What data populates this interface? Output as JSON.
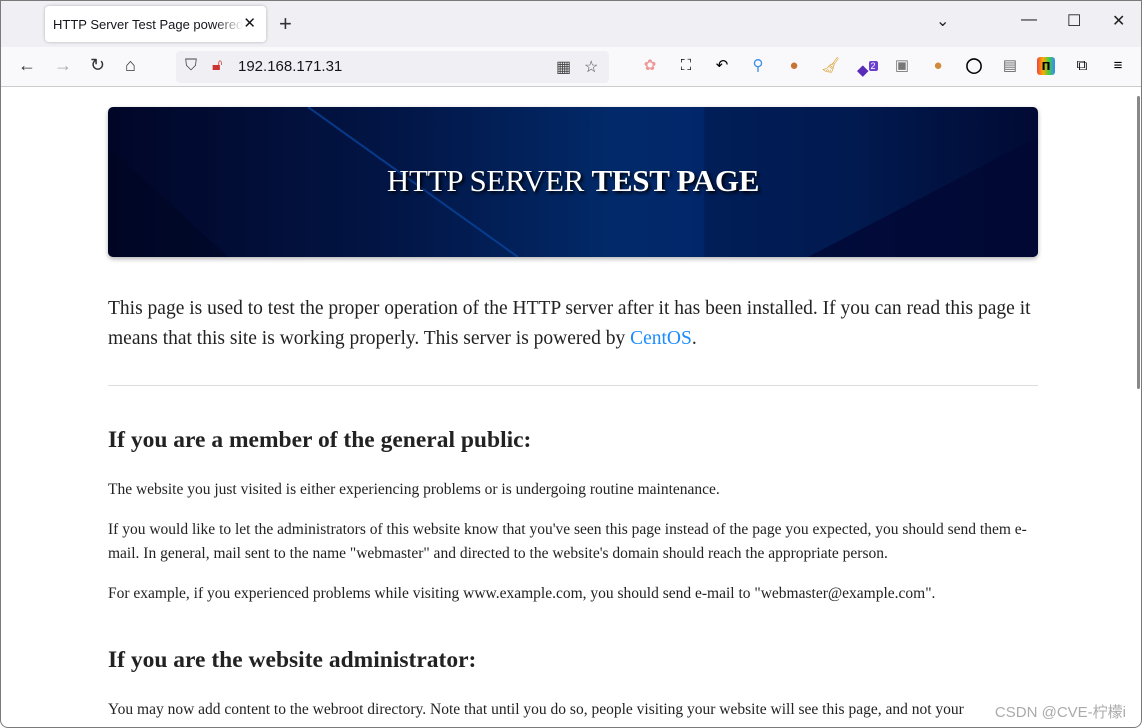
{
  "browser": {
    "tab_title": "HTTP Server Test Page powered by CentOS",
    "url": "192.168.171.31",
    "extension_badge": "2"
  },
  "page": {
    "banner_title_normal": "HTTP SERVER",
    "banner_title_bold": "TEST PAGE",
    "intro_text": "This page is used to test the proper operation of the HTTP server after it has been installed. If you can read this page it means that this site is working properly. This server is powered by ",
    "intro_link": "CentOS",
    "intro_end": ".",
    "public_heading": "If you are a member of the general public:",
    "public_p1": "The website you just visited is either experiencing problems or is undergoing routine maintenance.",
    "public_p2": "If you would like to let the administrators of this website know that you've seen this page instead of the page you expected, you should send them e-mail. In general, mail sent to the name \"webmaster\" and directed to the website's domain should reach the appropriate person.",
    "public_p3": "For example, if you experienced problems while visiting www.example.com, you should send e-mail to \"webmaster@example.com\".",
    "admin_heading": "If you are the website administrator:",
    "admin_p1": "You may now add content to the webroot directory. Note that until you do so, people visiting your website will see this page, and not your"
  },
  "watermark": "CSDN @CVE-柠檬i",
  "colors": {
    "link": "#1a8cff",
    "banner": "#022a6a"
  }
}
